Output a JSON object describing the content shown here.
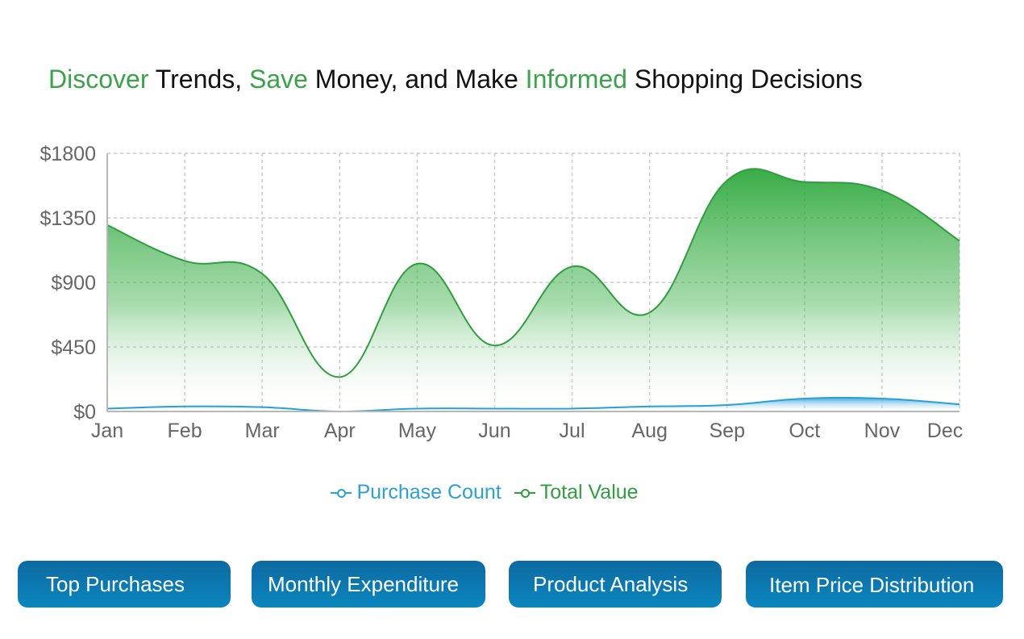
{
  "headline": {
    "w1": "Discover",
    "w2": " Trends, ",
    "w3": "Save",
    "w4": " Money, and Make ",
    "w5": "Informed",
    "w6": " Shopping Decisions"
  },
  "colors": {
    "accent_green": "#3aa34a",
    "purchase_count": "#2a9fd8",
    "total_value": "#2e9e3e",
    "button": "#0a7db6"
  },
  "chart_data": {
    "type": "area",
    "categories": [
      "Jan",
      "Feb",
      "Mar",
      "Apr",
      "May",
      "Jun",
      "Jul",
      "Aug",
      "Sep",
      "Oct",
      "Nov",
      "Dec"
    ],
    "series": [
      {
        "name": "Purchase Count",
        "values": [
          20,
          35,
          30,
          0,
          20,
          20,
          20,
          35,
          45,
          90,
          90,
          50
        ]
      },
      {
        "name": "Total Value",
        "values": [
          1300,
          1050,
          960,
          240,
          1030,
          460,
          1010,
          690,
          1610,
          1600,
          1540,
          1190
        ]
      }
    ],
    "y_tick_labels": [
      "$0",
      "$450",
      "$900",
      "$1350",
      "$1800"
    ],
    "y_ticks": [
      0,
      450,
      900,
      1350,
      1800
    ],
    "ylim": [
      0,
      1800
    ],
    "grid": true,
    "legend_position": "bottom-center"
  },
  "buttons": [
    {
      "label": "Top Purchases"
    },
    {
      "label": "Monthly Expenditure"
    },
    {
      "label": "Product Analysis"
    },
    {
      "label": "Item Price Distribution"
    }
  ]
}
